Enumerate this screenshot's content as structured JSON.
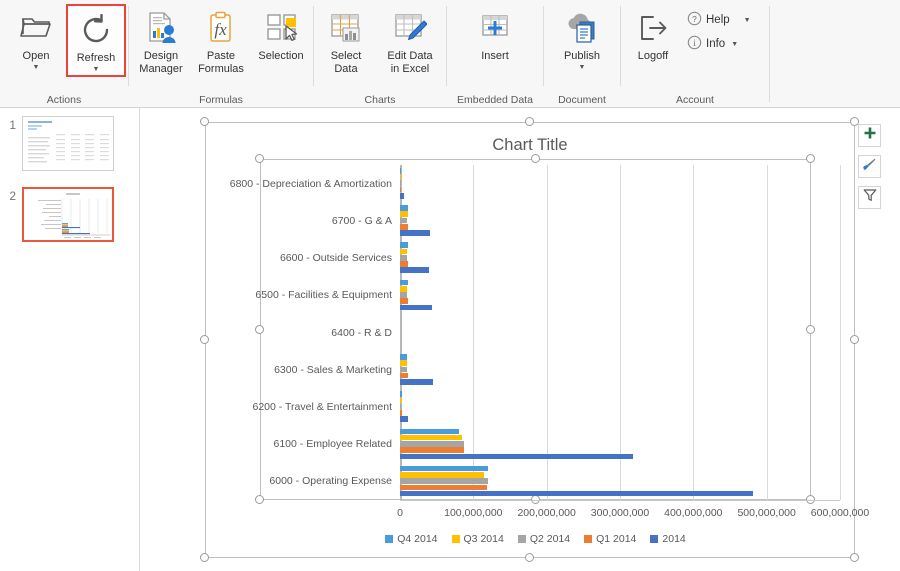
{
  "ribbon": {
    "groups": [
      {
        "name": "actions",
        "label": "Actions",
        "buttons": [
          {
            "id": "open",
            "label": "Open",
            "icon": "folder-open-icon",
            "has_caret": true,
            "highlighted": false
          },
          {
            "id": "refresh",
            "label": "Refresh",
            "icon": "refresh-icon",
            "has_caret": true,
            "highlighted": true
          }
        ]
      },
      {
        "name": "formulas",
        "label": "Formulas",
        "buttons": [
          {
            "id": "design-manager",
            "label": "Design\nManager",
            "icon": "design-manager-icon",
            "has_caret": false,
            "highlighted": false
          },
          {
            "id": "paste-formulas",
            "label": "Paste\nFormulas",
            "icon": "paste-formulas-icon",
            "has_caret": false,
            "highlighted": false
          },
          {
            "id": "selection",
            "label": "Selection",
            "icon": "selection-icon",
            "has_caret": false,
            "highlighted": false
          }
        ]
      },
      {
        "name": "charts",
        "label": "Charts",
        "buttons": [
          {
            "id": "select-data",
            "label": "Select\nData",
            "icon": "select-data-icon",
            "has_caret": false,
            "highlighted": false
          },
          {
            "id": "edit-data",
            "label": "Edit Data\nin Excel",
            "icon": "edit-data-icon",
            "has_caret": false,
            "highlighted": false
          }
        ]
      },
      {
        "name": "embedded-data",
        "label": "Embedded Data",
        "buttons": [
          {
            "id": "insert",
            "label": "Insert",
            "icon": "insert-table-icon",
            "has_caret": false,
            "highlighted": false
          }
        ]
      },
      {
        "name": "document",
        "label": "Document",
        "buttons": [
          {
            "id": "publish",
            "label": "Publish",
            "icon": "publish-cloud-icon",
            "has_caret": true,
            "highlighted": false
          }
        ]
      },
      {
        "name": "account",
        "label": "Account",
        "buttons": [
          {
            "id": "logoff",
            "label": "Logoff",
            "icon": "logoff-icon",
            "has_caret": false,
            "highlighted": false
          }
        ],
        "small_buttons": [
          {
            "id": "help",
            "label": "Help",
            "icon": "help-circle-icon",
            "has_caret": true
          },
          {
            "id": "info",
            "label": "Info",
            "icon": "info-circle-icon",
            "has_caret": true
          }
        ]
      }
    ]
  },
  "slide_pane": {
    "slides": [
      {
        "number": "1",
        "type": "table",
        "selected": false
      },
      {
        "number": "2",
        "type": "chart",
        "selected": true
      }
    ]
  },
  "chart_buttons": [
    {
      "id": "chart-elements",
      "icon": "plus-icon",
      "color": "#217346"
    },
    {
      "id": "chart-styles",
      "icon": "paintbrush-icon",
      "color": "#2b7cd3"
    },
    {
      "id": "chart-filters",
      "icon": "filter-icon",
      "color": "#595959"
    }
  ],
  "chart_data": {
    "type": "bar",
    "orientation": "horizontal",
    "title": "Chart Title",
    "xlabel": "",
    "ylabel": "",
    "xlim": [
      0,
      600000000
    ],
    "xticks": [
      0,
      100000000,
      200000000,
      300000000,
      400000000,
      500000000,
      600000000
    ],
    "xtick_labels": [
      "0",
      "100,000,000",
      "200,000,000",
      "300,000,000",
      "400,000,000",
      "500,000,000",
      "600,000,000"
    ],
    "grid": true,
    "legend_position": "bottom",
    "categories": [
      "6000 - Operating Expense",
      "6100 - Employee Related",
      "6200 - Travel & Entertainment",
      "6300 - Sales & Marketing",
      "6400 - R & D",
      "6500 - Facilities & Equipment",
      "6600 - Outside Services",
      "6700 - G & A",
      "6800 - Depreciation & Amortization"
    ],
    "series": [
      {
        "name": "Q4 2014",
        "color": "#4A9BDC",
        "values": [
          120000000,
          81000000,
          2700000,
          9500000,
          0,
          11000000,
          10500000,
          10500000,
          1300000
        ]
      },
      {
        "name": "Q3 2014",
        "color": "#FFC000",
        "values": [
          115000000,
          85000000,
          2400000,
          9500000,
          0,
          10000000,
          9500000,
          10500000,
          1300000
        ]
      },
      {
        "name": "Q2 2014",
        "color": "#A5A5A5",
        "values": [
          120000000,
          87000000,
          2000000,
          9500000,
          0,
          10000000,
          9500000,
          10000000,
          1000000
        ]
      },
      {
        "name": "Q1 2014",
        "color": "#ED7D31",
        "values": [
          119000000,
          87000000,
          2200000,
          11000000,
          0,
          11500000,
          11000000,
          11500000,
          1500000
        ]
      },
      {
        "name": "2014",
        "color": "#4472C4",
        "values": [
          481000000,
          318000000,
          11000000,
          45000000,
          0,
          43000000,
          39000000,
          40500000,
          6000000
        ]
      }
    ]
  }
}
